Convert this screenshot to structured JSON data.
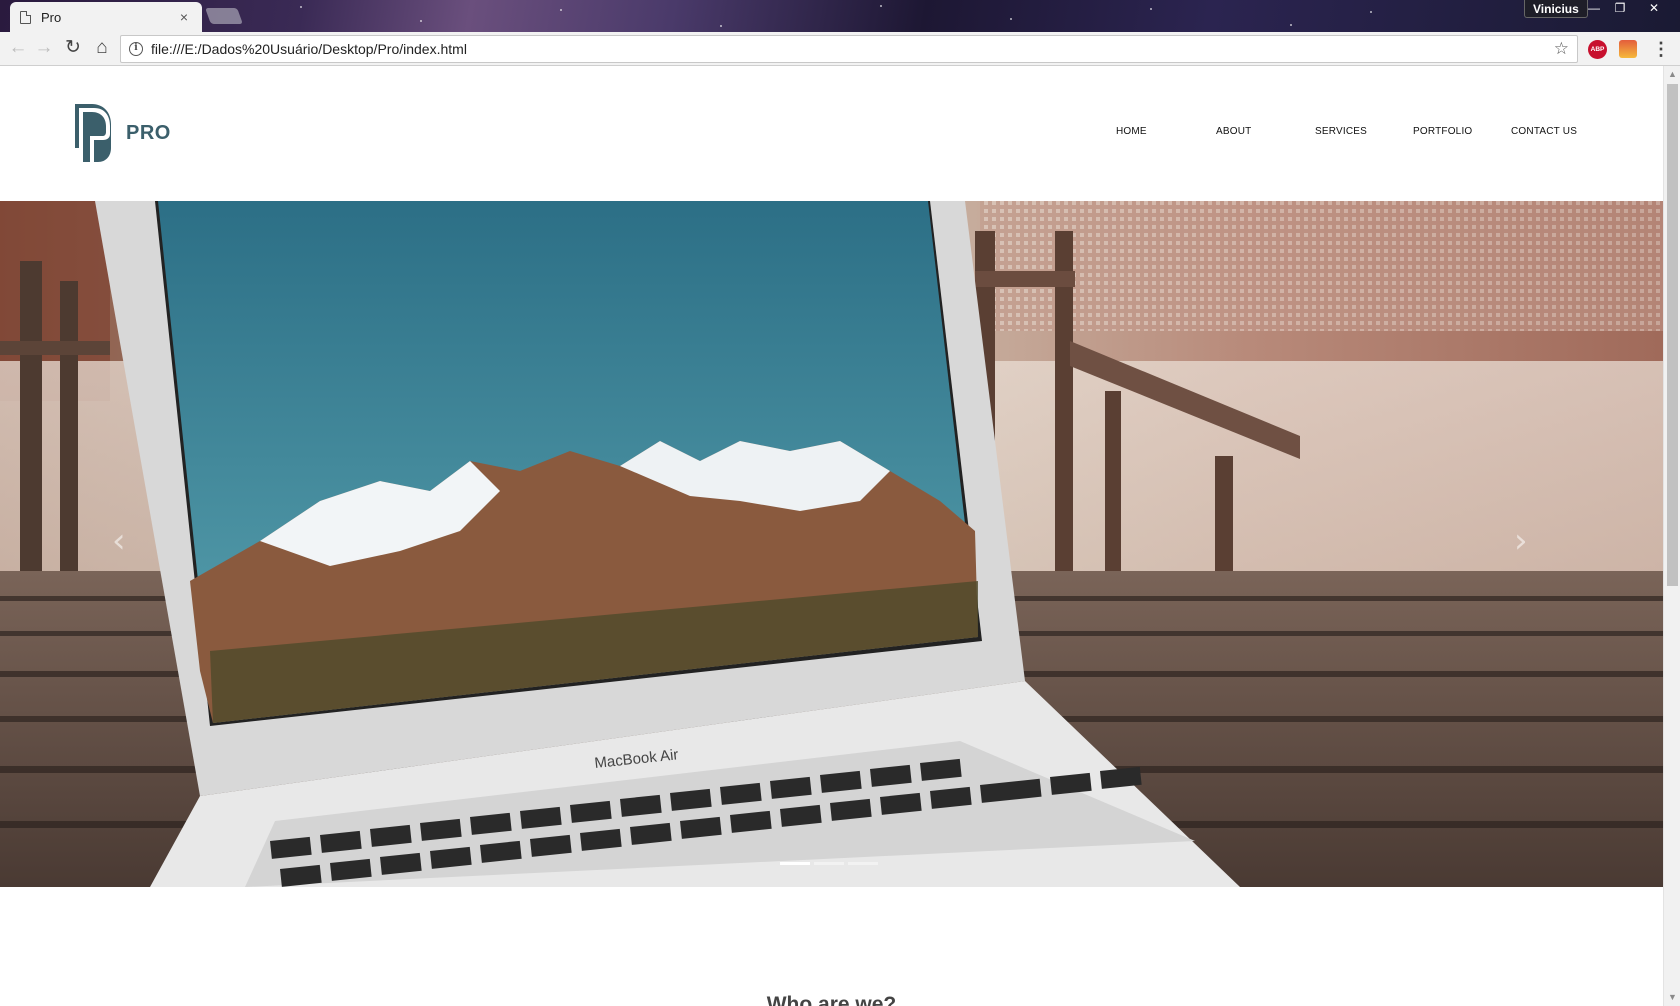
{
  "browser": {
    "tab_title": "Pro",
    "tab_close": "×",
    "profile_name": "Vinicius",
    "window_buttons": {
      "minimize": "—",
      "restore": "❐",
      "close": "✕"
    },
    "url": "file:///E:/Dados%20Usuário/Desktop/Pro/index.html",
    "back": "←",
    "forward": "→",
    "reload": "↻",
    "home": "⌂",
    "info": "i",
    "bookmark": "☆",
    "extensions": {
      "abp_label": "ABP"
    },
    "menu": "⋮"
  },
  "site": {
    "brand": "PRO",
    "nav": [
      "HOME",
      "ABOUT",
      "SERVICES",
      "PORTFOLIO",
      "CONTACT US"
    ],
    "carousel": {
      "prev": "‹",
      "next": "›",
      "slide_count": 3,
      "active_slide": 1,
      "laptop_brand": "MacBook Air"
    },
    "section_title": "Who are we?"
  },
  "colors": {
    "brand": "#3b5f6b",
    "nav_text": "#111111"
  }
}
